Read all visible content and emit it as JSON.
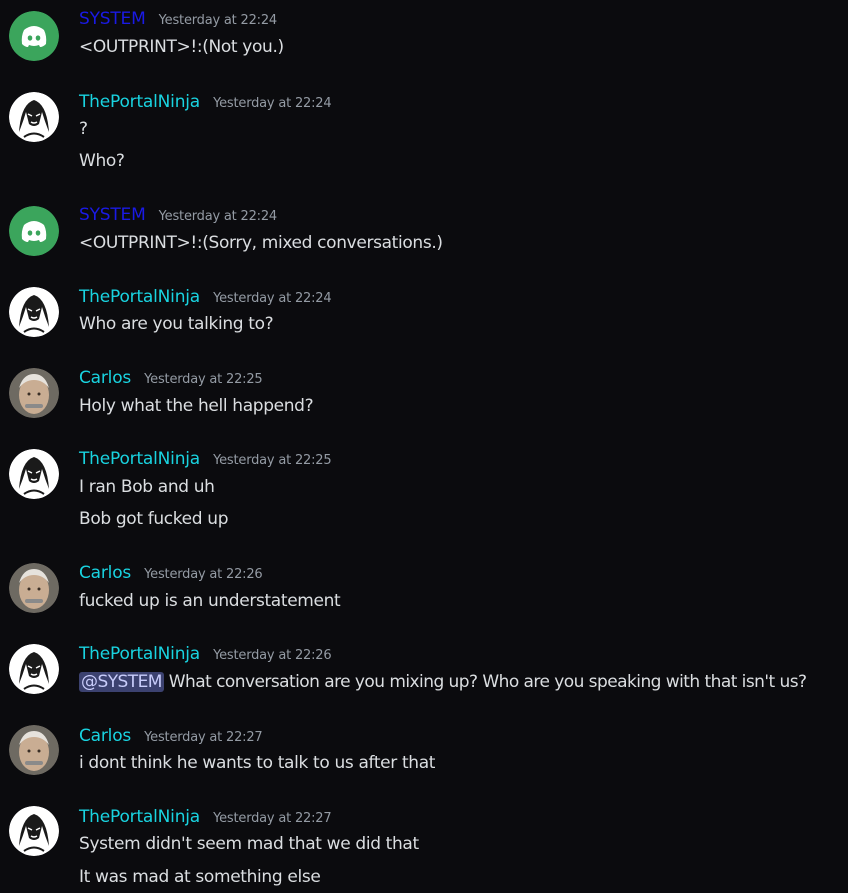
{
  "colors": {
    "background": "#0b0b0e",
    "system_name": "#1a1ae6",
    "user_name": "#19d3e0",
    "timestamp": "#949ba4",
    "text": "#dbdee1",
    "mention_bg": "#3c4270",
    "discord_avatar_bg": "#3ba55c"
  },
  "messages": [
    {
      "author": "SYSTEM",
      "avatar": "discord-logo-avatar",
      "timestamp": "Yesterday at 22:24",
      "lines": [
        "<OUTPRINT>!:(Not you.)"
      ]
    },
    {
      "author": "ThePortalNinja",
      "avatar": "sketch-face-avatar",
      "timestamp": "Yesterday at 22:24",
      "lines": [
        "?",
        "Who?"
      ]
    },
    {
      "author": "SYSTEM",
      "avatar": "discord-logo-avatar",
      "timestamp": "Yesterday at 22:24",
      "lines": [
        "<OUTPRINT>!:(Sorry, mixed conversations.)"
      ]
    },
    {
      "author": "ThePortalNinja",
      "avatar": "sketch-face-avatar",
      "timestamp": "Yesterday at 22:24",
      "lines": [
        "Who are you talking to?"
      ]
    },
    {
      "author": "Carlos",
      "avatar": "old-man-avatar",
      "timestamp": "Yesterday at 22:25",
      "lines": [
        "Holy what the hell happend?"
      ]
    },
    {
      "author": "ThePortalNinja",
      "avatar": "sketch-face-avatar",
      "timestamp": "Yesterday at 22:25",
      "lines": [
        "I ran Bob and uh",
        "Bob got fucked up"
      ]
    },
    {
      "author": "Carlos",
      "avatar": "old-man-avatar",
      "timestamp": "Yesterday at 22:26",
      "lines": [
        "fucked up is an understatement"
      ]
    },
    {
      "author": "ThePortalNinja",
      "avatar": "sketch-face-avatar",
      "timestamp": "Yesterday at 22:26",
      "mention": "@SYSTEM",
      "lines": [
        " What conversation are you mixing up? Who are you speaking with that isn't us?"
      ]
    },
    {
      "author": "Carlos",
      "avatar": "old-man-avatar",
      "timestamp": "Yesterday at 22:27",
      "lines": [
        "i dont think he wants to talk to us after that"
      ]
    },
    {
      "author": "ThePortalNinja",
      "avatar": "sketch-face-avatar",
      "timestamp": "Yesterday at 22:27",
      "lines": [
        "System didn't seem mad that we did that",
        "It was mad at something else"
      ]
    }
  ]
}
